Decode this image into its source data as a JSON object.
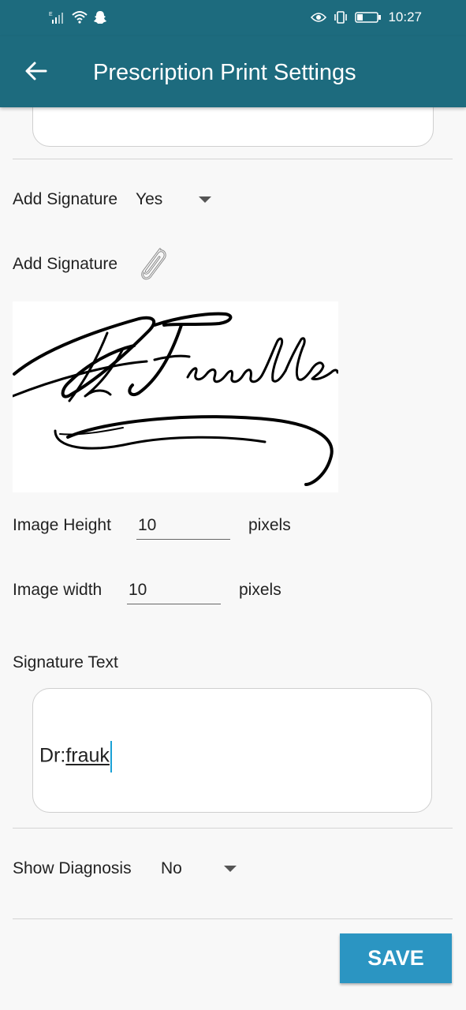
{
  "status_bar": {
    "time": "10:27",
    "icons": [
      "signal-icon",
      "wifi-icon",
      "snapchat-icon",
      "eye-icon",
      "vibrate-icon",
      "battery-icon"
    ]
  },
  "app_bar": {
    "title": "Prescription Print Settings",
    "back_icon": "arrow-left-icon",
    "background": "#1d6b7e"
  },
  "add_signature_select": {
    "label": "Add Signature",
    "value": "Yes"
  },
  "add_signature_attach": {
    "label": "Add Signature",
    "icon": "paperclip-icon"
  },
  "image_height": {
    "label": "Image Height",
    "value": "10",
    "unit": "pixels"
  },
  "image_width": {
    "label": "Image width",
    "value": "10",
    "unit": "pixels"
  },
  "signature_text": {
    "label": "Signature Text",
    "prefix": "Dr:",
    "word": "frauk"
  },
  "show_diagnosis": {
    "label": "Show Diagnosis",
    "value": "No"
  },
  "save_button": {
    "label": "SAVE",
    "color": "#2b95c2"
  }
}
